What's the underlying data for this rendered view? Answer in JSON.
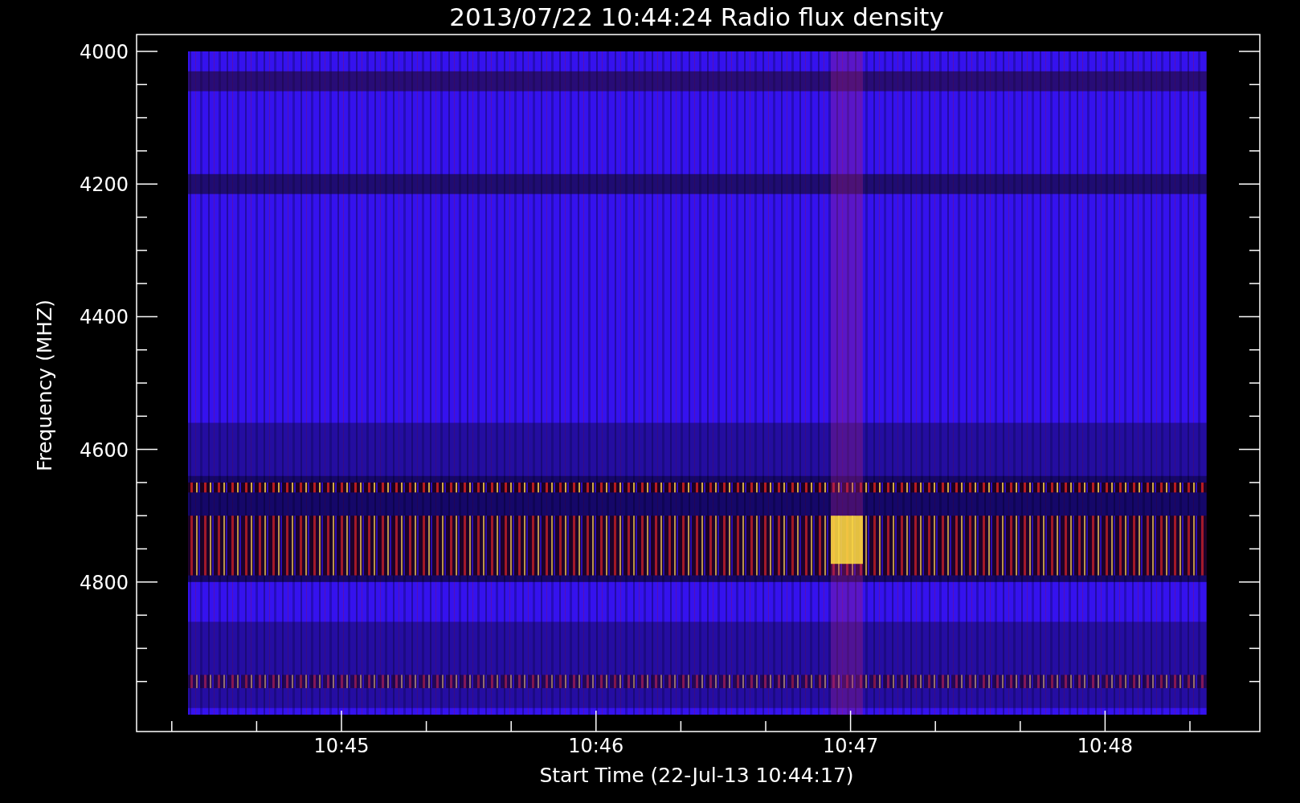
{
  "title": "2013/07/22 10:44:24 Radio flux density",
  "y_axis": {
    "label": "Frequency (MHZ)",
    "ticks": [
      "4000",
      "4200",
      "4400",
      "4600",
      "4800"
    ]
  },
  "x_axis": {
    "label": "Start Time (22-Jul-13 10:44:17)",
    "ticks": [
      "10:45",
      "10:46",
      "10:47",
      "10:48"
    ]
  }
}
